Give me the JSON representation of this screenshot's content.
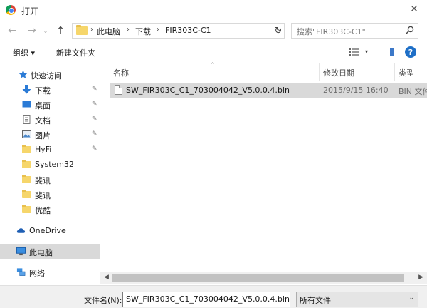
{
  "window": {
    "title": "打开",
    "close": "✕"
  },
  "nav": {
    "back": "←",
    "forward": "→",
    "history": "⌄",
    "up": "↑",
    "breadcrumb": [
      "此电脑",
      "下载",
      "FIR303C-C1"
    ],
    "separator": "›",
    "address_dropdown": "⌄",
    "refresh": "↻",
    "search_placeholder": "搜索\"FIR303C-C1\""
  },
  "toolbar": {
    "organize": "组织 ▾",
    "new_folder": "新建文件夹",
    "view_dropdown": "▾",
    "help": "?"
  },
  "sidebar": {
    "items": [
      {
        "label": "快速访问",
        "icon": "star-icon",
        "pinned": false
      },
      {
        "label": "下载",
        "icon": "download-icon",
        "pinned": true
      },
      {
        "label": "桌面",
        "icon": "desktop-icon",
        "pinned": true
      },
      {
        "label": "文档",
        "icon": "document-icon",
        "pinned": true
      },
      {
        "label": "图片",
        "icon": "picture-icon",
        "pinned": true
      },
      {
        "label": "HyFi",
        "icon": "folder-icon",
        "pinned": true
      },
      {
        "label": "System32",
        "icon": "folder-icon",
        "pinned": false
      },
      {
        "label": "斐讯",
        "icon": "folder-icon",
        "pinned": false
      },
      {
        "label": "斐讯",
        "icon": "folder-icon",
        "pinned": false
      },
      {
        "label": "优酷",
        "icon": "folder-icon",
        "pinned": false
      },
      {
        "label": "OneDrive",
        "icon": "cloud-icon",
        "pinned": false
      },
      {
        "label": "此电脑",
        "icon": "computer-icon",
        "pinned": false,
        "selected": true
      },
      {
        "label": "网络",
        "icon": "network-icon",
        "pinned": false
      }
    ],
    "pin_glyph": "📌"
  },
  "columns": {
    "name": "名称",
    "date": "修改日期",
    "type": "类型",
    "sort_glyph": "⌃"
  },
  "files": [
    {
      "name": "SW_FIR303C_C1_703004042_V5.0.0.4.bin",
      "date": "2015/9/15 16:40",
      "type": "BIN 文件"
    }
  ],
  "scroll": {
    "left": "◀",
    "right": "▶"
  },
  "bottom": {
    "filename_label": "文件名(N):",
    "filename_value": "SW_FIR303C_C1_703004042_V5.0.0.4.bin",
    "dropdown": "⌄",
    "filetype_value": "所有文件"
  },
  "colors": {
    "selection": "#d9d9d9",
    "folder": "#f6d66b",
    "accent": "#1e6fc7"
  }
}
